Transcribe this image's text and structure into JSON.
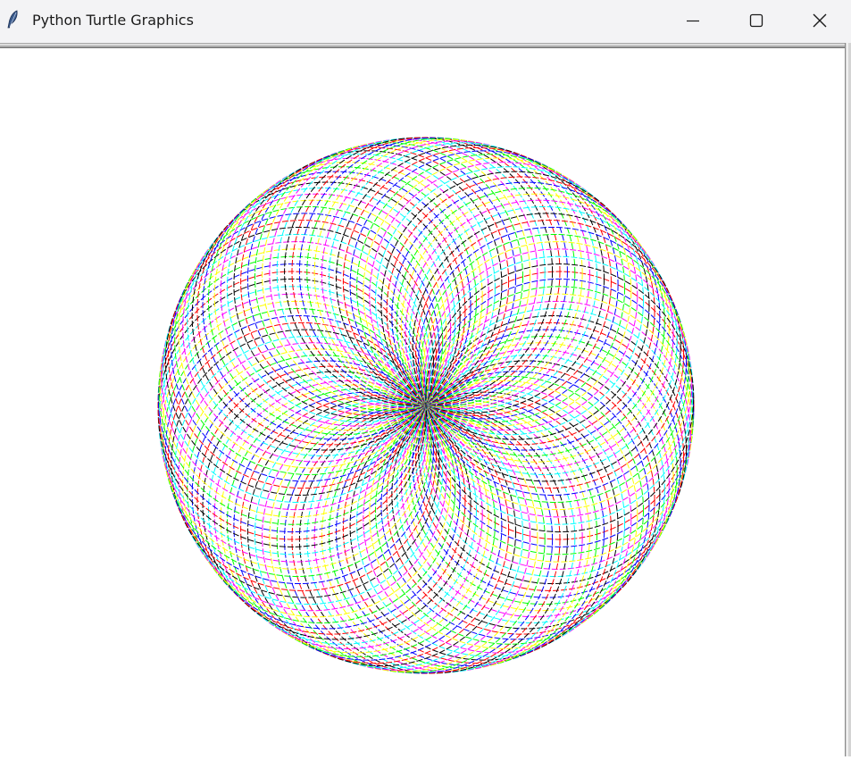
{
  "window": {
    "title": "Python Turtle Graphics",
    "controls": {
      "minimize": "minimize-icon",
      "maximize": "maximize-icon",
      "close": "close-icon"
    },
    "app_icon": "feather-icon"
  },
  "drawing": {
    "description_colors": [
      "#ff0000",
      "#0000ff",
      "#00ff00",
      "#ffff00",
      "#ff00ff",
      "#00ffff",
      "#000000"
    ],
    "pattern": "spirograph",
    "background": "#ffffff"
  }
}
